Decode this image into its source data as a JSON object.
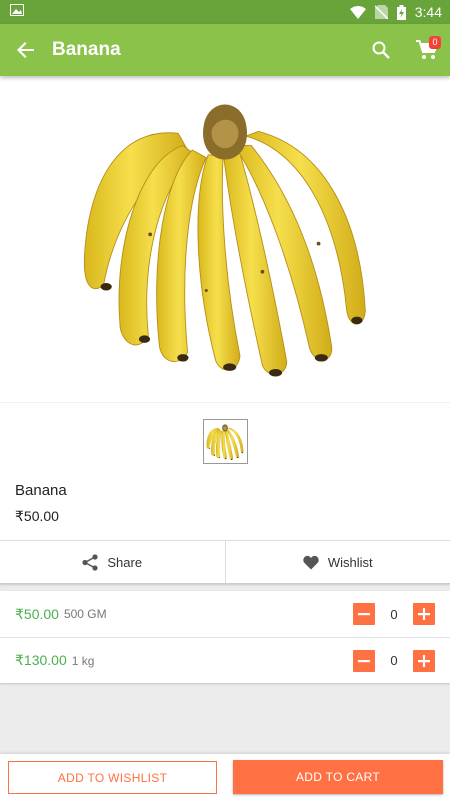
{
  "status_bar": {
    "time": "3:44",
    "icons": [
      "image-notification-icon",
      "wifi-icon",
      "no-sim-icon",
      "battery-icon"
    ]
  },
  "app_bar": {
    "title": "Banana",
    "cart_count": "0",
    "icons": [
      "back-arrow-icon",
      "search-icon",
      "cart-icon"
    ]
  },
  "product": {
    "name": "Banana",
    "price": "₹50.00"
  },
  "actions": {
    "share_label": "Share",
    "wishlist_label": "Wishlist"
  },
  "variants": [
    {
      "price": "₹50.00",
      "unit": "500 GM",
      "qty": "0"
    },
    {
      "price": "₹130.00",
      "unit": "1 kg",
      "qty": "0"
    }
  ],
  "bottom": {
    "wishlist_label": "ADD TO WISHLIST",
    "cart_label": "ADD TO CART"
  },
  "colors": {
    "status_bar": "#68a43a",
    "app_bar": "#8bc34a",
    "accent": "#ff7043",
    "price_green": "#4caf50",
    "badge": "#f44336"
  }
}
